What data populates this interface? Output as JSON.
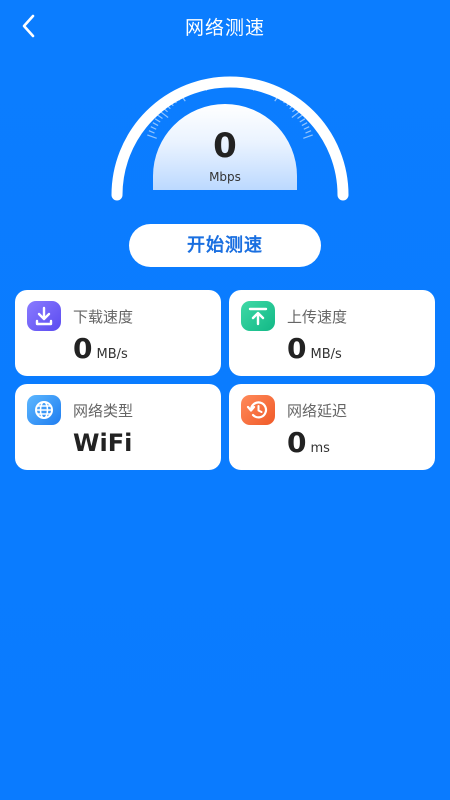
{
  "header": {
    "title": "网络测速"
  },
  "gauge": {
    "value": "0",
    "unit": "Mbps"
  },
  "start_button": {
    "label": "开始测速"
  },
  "cards": [
    {
      "label": "下载速度",
      "value": "0",
      "unit": "MB/s",
      "icon": "download-icon"
    },
    {
      "label": "上传速度",
      "value": "0",
      "unit": "MB/s",
      "icon": "upload-icon"
    },
    {
      "label": "网络类型",
      "value": "WiFi",
      "unit": "",
      "icon": "globe-icon"
    },
    {
      "label": "网络延迟",
      "value": "0",
      "unit": "ms",
      "icon": "history-icon"
    }
  ],
  "colors": {
    "background": "#0a7cff",
    "accent": "#1a6fe0"
  }
}
